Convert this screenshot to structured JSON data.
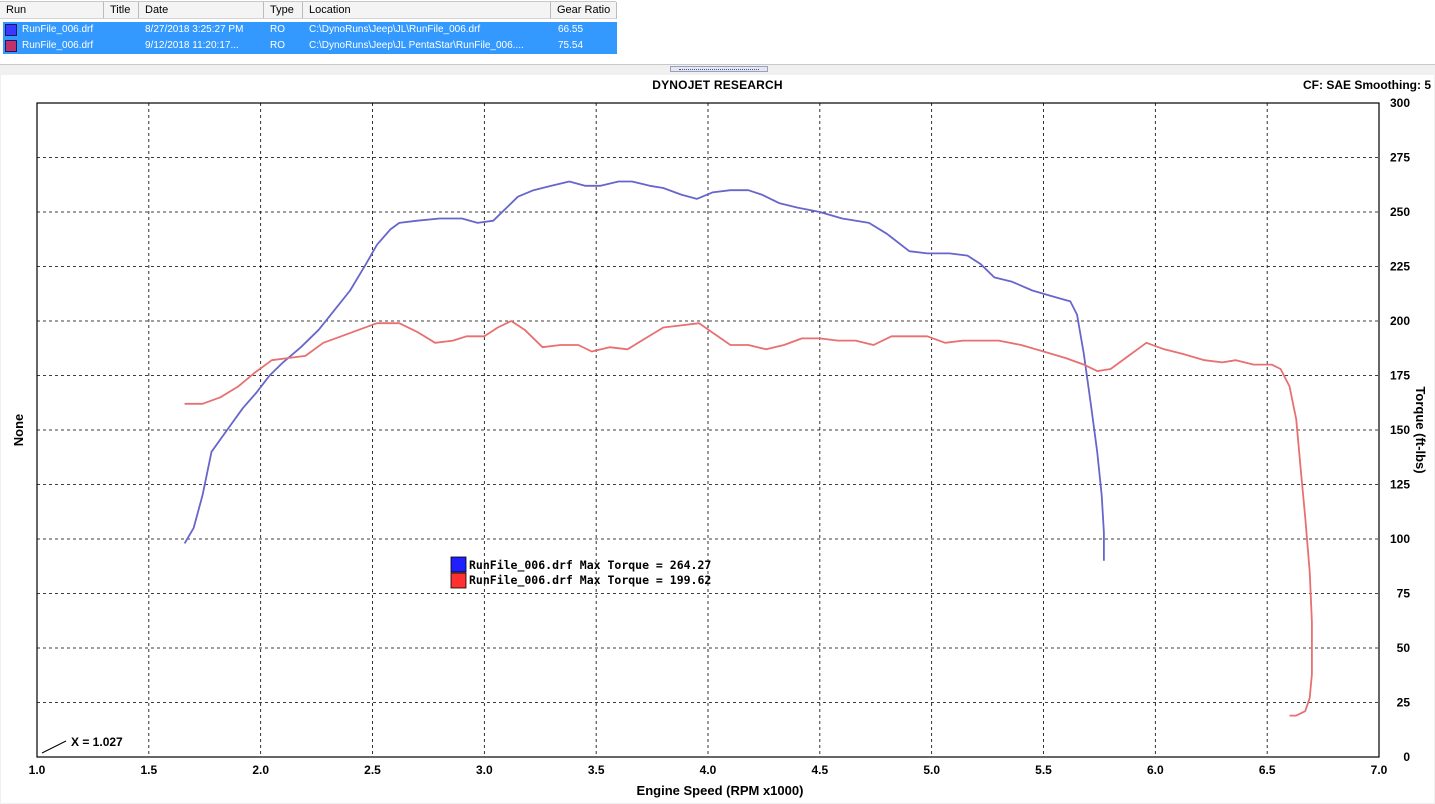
{
  "run_table": {
    "headers": [
      "Run",
      "Title",
      "Date",
      "Type",
      "Location",
      "Gear Ratio"
    ],
    "rows": [
      {
        "run": "RunFile_006.drf",
        "title": "",
        "date": "8/27/2018 3:25:27 PM",
        "type": "RO",
        "location": "C:\\DynoRuns\\Jeep\\JL\\RunFile_006.drf",
        "gear_ratio": "66.55",
        "swatch_color": "#3a3aff"
      },
      {
        "run": "RunFile_006.drf",
        "title": "",
        "date": "9/12/2018 11:20:17...",
        "type": "RO",
        "location": "C:\\DynoRuns\\Jeep\\JL PentaStar\\RunFile_006....",
        "gear_ratio": "75.54",
        "swatch_color": "#c0306a"
      }
    ],
    "selected_color": "#3399ff"
  },
  "chart_header": {
    "title": "DYNOJET RESEARCH",
    "correction": "CF: SAE  Smoothing: 5"
  },
  "chart_data": {
    "type": "line",
    "title": "DYNOJET RESEARCH",
    "xlabel": "Engine Speed (RPM x1000)",
    "ylabel_left": "None",
    "ylabel_right": "Torque (ft-lbs)",
    "xlim": [
      1.0,
      7.0
    ],
    "ylim": [
      0,
      300
    ],
    "x_ticks": [
      "1.0",
      "1.5",
      "2.0",
      "2.5",
      "3.0",
      "3.5",
      "4.0",
      "4.5",
      "5.0",
      "5.5",
      "6.0",
      "6.5",
      "7.0"
    ],
    "y_ticks": [
      "0",
      "25",
      "50",
      "75",
      "100",
      "125",
      "150",
      "175",
      "200",
      "225",
      "250",
      "275",
      "300"
    ],
    "grid": true,
    "cursor_readout": "X = 1.027",
    "legend": [
      {
        "text": "RunFile_006.drf Max Torque = 264.27",
        "color": "#2020ff"
      },
      {
        "text": "RunFile_006.drf Max Torque = 199.62",
        "color": "#ff3030"
      }
    ],
    "series": [
      {
        "name": "RunFile_006.drf",
        "color": "#6666cc",
        "points": [
          [
            1.66,
            98
          ],
          [
            1.7,
            105
          ],
          [
            1.74,
            120
          ],
          [
            1.78,
            140
          ],
          [
            1.85,
            150
          ],
          [
            1.92,
            160
          ],
          [
            1.98,
            167
          ],
          [
            2.04,
            175
          ],
          [
            2.1,
            181
          ],
          [
            2.18,
            188
          ],
          [
            2.26,
            196
          ],
          [
            2.33,
            205
          ],
          [
            2.4,
            214
          ],
          [
            2.47,
            226
          ],
          [
            2.52,
            235
          ],
          [
            2.58,
            242
          ],
          [
            2.62,
            245
          ],
          [
            2.7,
            246
          ],
          [
            2.8,
            247
          ],
          [
            2.9,
            247
          ],
          [
            2.97,
            245
          ],
          [
            3.04,
            246
          ],
          [
            3.1,
            252
          ],
          [
            3.15,
            257
          ],
          [
            3.22,
            260
          ],
          [
            3.3,
            262
          ],
          [
            3.38,
            264
          ],
          [
            3.45,
            262
          ],
          [
            3.52,
            262
          ],
          [
            3.6,
            264
          ],
          [
            3.66,
            264
          ],
          [
            3.74,
            262
          ],
          [
            3.8,
            261
          ],
          [
            3.88,
            258
          ],
          [
            3.95,
            256
          ],
          [
            4.02,
            259
          ],
          [
            4.1,
            260
          ],
          [
            4.18,
            260
          ],
          [
            4.24,
            258
          ],
          [
            4.32,
            254
          ],
          [
            4.4,
            252
          ],
          [
            4.5,
            250
          ],
          [
            4.6,
            247
          ],
          [
            4.72,
            245
          ],
          [
            4.8,
            240
          ],
          [
            4.9,
            232
          ],
          [
            4.98,
            231
          ],
          [
            5.08,
            231
          ],
          [
            5.16,
            230
          ],
          [
            5.22,
            226
          ],
          [
            5.28,
            220
          ],
          [
            5.36,
            218
          ],
          [
            5.45,
            214
          ],
          [
            5.55,
            211
          ],
          [
            5.62,
            209
          ],
          [
            5.65,
            203
          ],
          [
            5.68,
            185
          ],
          [
            5.71,
            163
          ],
          [
            5.74,
            140
          ],
          [
            5.76,
            120
          ],
          [
            5.77,
            103
          ],
          [
            5.77,
            90
          ]
        ]
      },
      {
        "name": "RunFile_006.drf",
        "color": "#e87070",
        "points": [
          [
            1.66,
            162
          ],
          [
            1.74,
            162
          ],
          [
            1.82,
            165
          ],
          [
            1.9,
            170
          ],
          [
            1.97,
            176
          ],
          [
            2.05,
            182
          ],
          [
            2.12,
            183
          ],
          [
            2.2,
            184
          ],
          [
            2.28,
            190
          ],
          [
            2.36,
            193
          ],
          [
            2.44,
            196
          ],
          [
            2.52,
            199
          ],
          [
            2.62,
            199
          ],
          [
            2.7,
            195
          ],
          [
            2.78,
            190
          ],
          [
            2.86,
            191
          ],
          [
            2.92,
            193
          ],
          [
            3.0,
            193
          ],
          [
            3.06,
            197
          ],
          [
            3.12,
            200
          ],
          [
            3.18,
            196
          ],
          [
            3.26,
            188
          ],
          [
            3.34,
            189
          ],
          [
            3.42,
            189
          ],
          [
            3.48,
            186
          ],
          [
            3.56,
            188
          ],
          [
            3.64,
            187
          ],
          [
            3.72,
            192
          ],
          [
            3.8,
            197
          ],
          [
            3.88,
            198
          ],
          [
            3.96,
            199
          ],
          [
            4.03,
            194
          ],
          [
            4.1,
            189
          ],
          [
            4.18,
            189
          ],
          [
            4.26,
            187
          ],
          [
            4.34,
            189
          ],
          [
            4.42,
            192
          ],
          [
            4.5,
            192
          ],
          [
            4.58,
            191
          ],
          [
            4.66,
            191
          ],
          [
            4.74,
            189
          ],
          [
            4.82,
            193
          ],
          [
            4.9,
            193
          ],
          [
            4.98,
            193
          ],
          [
            5.06,
            190
          ],
          [
            5.14,
            191
          ],
          [
            5.22,
            191
          ],
          [
            5.3,
            191
          ],
          [
            5.4,
            189
          ],
          [
            5.5,
            186
          ],
          [
            5.6,
            183
          ],
          [
            5.68,
            180
          ],
          [
            5.74,
            177
          ],
          [
            5.8,
            178
          ],
          [
            5.88,
            184
          ],
          [
            5.96,
            190
          ],
          [
            6.04,
            187
          ],
          [
            6.12,
            185
          ],
          [
            6.22,
            182
          ],
          [
            6.3,
            181
          ],
          [
            6.36,
            182
          ],
          [
            6.44,
            180
          ],
          [
            6.52,
            180
          ],
          [
            6.56,
            178
          ],
          [
            6.6,
            170
          ],
          [
            6.63,
            155
          ],
          [
            6.65,
            132
          ],
          [
            6.67,
            110
          ],
          [
            6.69,
            85
          ],
          [
            6.7,
            62
          ],
          [
            6.7,
            38
          ],
          [
            6.69,
            27
          ],
          [
            6.67,
            21
          ],
          [
            6.63,
            19
          ],
          [
            6.6,
            19
          ]
        ]
      }
    ]
  }
}
